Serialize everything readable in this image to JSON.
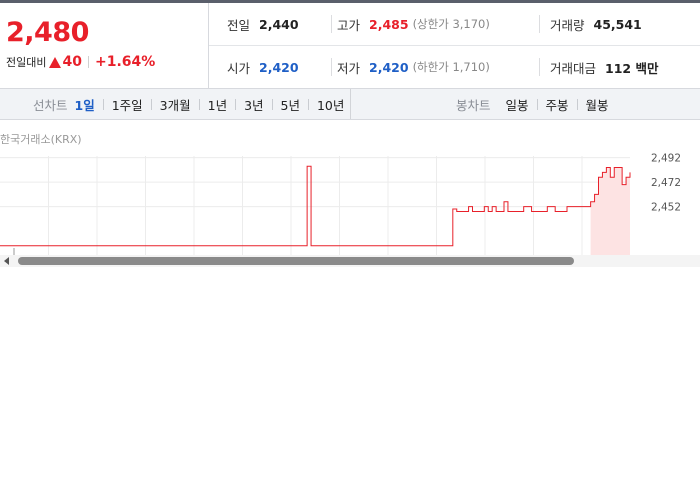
{
  "quote": {
    "price": "2,480",
    "change_label": "전일대비",
    "change_value": "40",
    "change_pct": "+1.64%",
    "prev_close_label": "전일",
    "prev_close": "2,440",
    "high_label": "고가",
    "high": "2,485",
    "upper_limit": "(상한가 3,170)",
    "volume_label": "거래량",
    "volume": "45,541",
    "open_label": "시가",
    "open": "2,420",
    "low_label": "저가",
    "low": "2,420",
    "lower_limit": "(하한가 1,710)",
    "amount_label": "거래대금",
    "amount": "112 백만"
  },
  "tabs": {
    "line_title": "선차트",
    "line_items": [
      "1일",
      "1주일",
      "3개월",
      "1년",
      "3년",
      "5년",
      "10년"
    ],
    "line_active": "1일",
    "candle_title": "봉차트",
    "candle_items": [
      "일봉",
      "주봉",
      "월봉"
    ]
  },
  "source": "한국거래소(KRX)",
  "colors": {
    "up": "#e8202a",
    "blue": "#1f5fc6"
  },
  "chart_data": {
    "type": "line",
    "y_ticks": [
      "2,492",
      "2,472",
      "2,452"
    ],
    "ylim": [
      2410,
      2495
    ],
    "grid": true,
    "x": [
      0,
      1,
      2,
      3,
      4,
      5,
      6,
      7,
      8,
      9,
      10,
      11,
      12,
      13,
      14,
      15,
      16,
      17,
      18,
      19,
      20,
      21,
      22,
      23,
      24,
      25,
      26,
      27,
      28,
      29,
      30,
      31,
      32,
      33,
      34,
      35,
      36,
      37,
      38,
      39,
      40,
      41,
      42,
      43,
      44,
      45,
      46,
      47,
      48,
      49,
      50,
      51,
      52,
      53,
      54,
      55,
      56,
      57,
      58,
      59,
      60,
      61,
      62,
      63,
      64,
      65,
      66,
      67,
      68,
      69,
      70,
      71,
      72,
      73,
      74,
      75,
      76,
      77,
      78,
      79,
      80,
      81,
      82,
      83,
      84,
      85,
      86,
      87,
      88,
      89,
      90,
      91,
      92,
      93,
      94,
      95,
      96,
      97,
      98,
      99,
      100,
      101,
      102,
      103,
      104,
      105,
      106,
      107,
      108,
      109,
      110,
      111,
      112,
      113,
      114,
      115,
      116,
      117,
      118,
      119,
      120,
      121,
      122,
      123,
      124,
      125,
      126,
      127,
      128,
      129,
      130,
      131,
      132,
      133,
      134,
      135,
      136,
      137,
      138,
      139,
      140,
      141,
      142,
      143,
      144,
      145,
      146,
      147,
      148,
      149,
      150,
      151,
      152,
      153,
      154,
      155,
      156,
      157,
      158,
      159,
      160
    ],
    "values": [
      2420,
      2420,
      2420,
      2420,
      2420,
      2420,
      2420,
      2420,
      2420,
      2420,
      2420,
      2420,
      2420,
      2420,
      2420,
      2420,
      2420,
      2420,
      2420,
      2420,
      2420,
      2420,
      2420,
      2420,
      2420,
      2420,
      2420,
      2420,
      2420,
      2420,
      2420,
      2420,
      2420,
      2420,
      2420,
      2420,
      2420,
      2420,
      2420,
      2420,
      2420,
      2420,
      2420,
      2420,
      2420,
      2420,
      2420,
      2420,
      2420,
      2420,
      2420,
      2420,
      2420,
      2420,
      2420,
      2420,
      2420,
      2420,
      2420,
      2420,
      2420,
      2420,
      2420,
      2420,
      2420,
      2420,
      2420,
      2420,
      2420,
      2420,
      2420,
      2420,
      2420,
      2420,
      2420,
      2420,
      2420,
      2420,
      2485,
      2420,
      2420,
      2420,
      2420,
      2420,
      2420,
      2420,
      2420,
      2420,
      2420,
      2420,
      2420,
      2420,
      2420,
      2420,
      2420,
      2420,
      2420,
      2420,
      2420,
      2420,
      2420,
      2420,
      2420,
      2420,
      2420,
      2420,
      2420,
      2420,
      2420,
      2420,
      2420,
      2420,
      2420,
      2420,
      2420,
      2450,
      2448,
      2448,
      2448,
      2452,
      2448,
      2448,
      2448,
      2452,
      2448,
      2452,
      2448,
      2448,
      2456,
      2448,
      2448,
      2448,
      2448,
      2452,
      2452,
      2448,
      2448,
      2448,
      2448,
      2452,
      2452,
      2448,
      2448,
      2448,
      2452,
      2452,
      2452,
      2452,
      2452,
      2452,
      2456,
      2462,
      2476,
      2480,
      2484,
      2476,
      2484,
      2484,
      2470,
      2476,
      2480,
      2480
    ]
  }
}
